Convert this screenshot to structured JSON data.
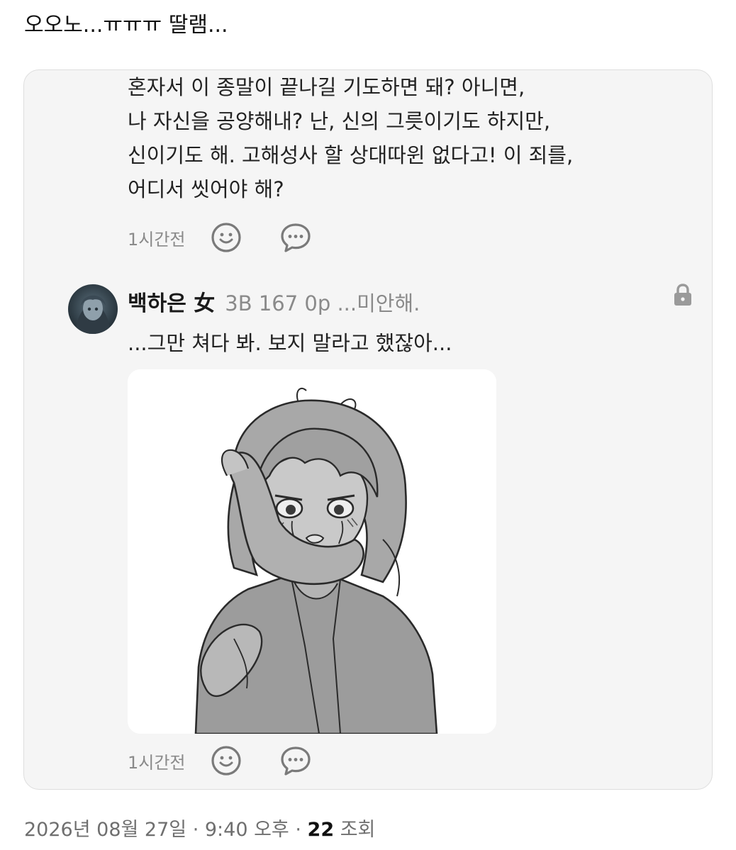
{
  "tweet": {
    "text": "오오노...ㅠㅠㅠ 딸램..."
  },
  "comment": {
    "lines": [
      "혼자서 이 종말이 끝나길 기도하면 돼? 아니면,",
      "나 자신을 공양해내? 난, 신의 그릇이기도 하지만,",
      "신이기도 해. 고해성사 할 상대따윈 없다고! 이 죄를,",
      "어디서 씻어야 해?"
    ],
    "time": "1시간전",
    "icons": [
      "smiley-icon",
      "chat-bubble-icon"
    ]
  },
  "reply": {
    "name": "백하은 女",
    "status": "3B 167 0p ...미안해.",
    "text": "...그만 쳐다 봐. 보지 말라고 했잖아...",
    "time": "1시간전",
    "icons": [
      "avatar-image",
      "lock-icon",
      "manga-drawing-image",
      "smiley-icon",
      "chat-bubble-icon"
    ]
  },
  "footer": {
    "date": "2026년 08월 27일",
    "sep1": " · ",
    "clock": "9:40 오후",
    "sep2": " · ",
    "views": "22",
    "views_label": " 조회"
  },
  "colors": {
    "card_bg": "#f5f5f5",
    "card_border": "#dedede",
    "muted_text": "#8a8a8a",
    "icon_stroke": "#7a7a7a"
  }
}
